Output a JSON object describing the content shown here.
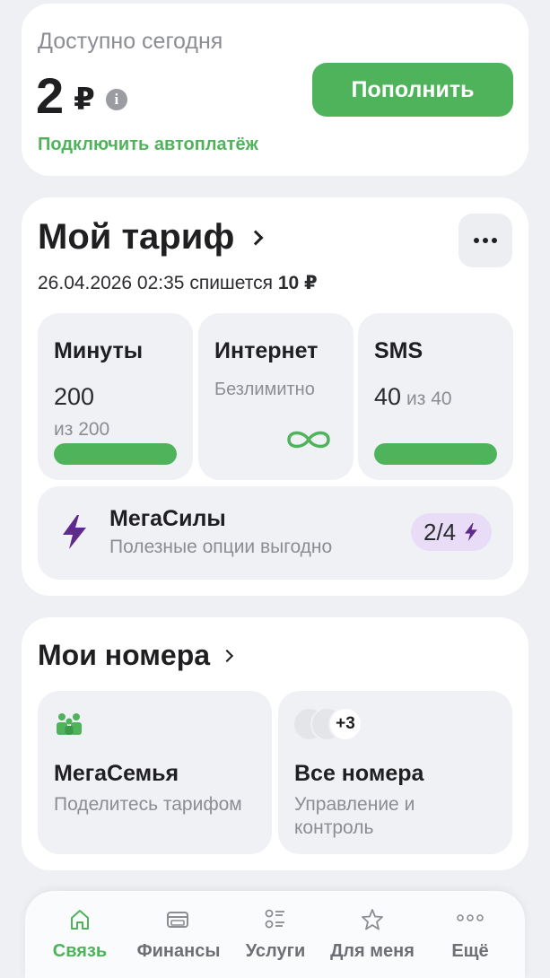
{
  "balance": {
    "caption": "Доступно сегодня",
    "amount": "2",
    "currency": "₽",
    "info_icon": "i",
    "topup_label": "Пополнить",
    "autopay_label": "Подключить автоплатёж"
  },
  "tariff": {
    "title": "Мой тариф",
    "date_text": "26.04.2026 02:35 спишется",
    "charge": "10 ₽",
    "packages": {
      "minutes": {
        "title": "Минуты",
        "value": "200",
        "sub": "из 200",
        "fill": 1.0
      },
      "internet": {
        "title": "Интернет",
        "value": "Безлимитно",
        "icon": "infinity-icon"
      },
      "sms": {
        "title": "SMS",
        "value": "40",
        "sub": "из 40",
        "fill": 1.0
      }
    },
    "megasily": {
      "title": "МегаСилы",
      "subtitle": "Полезные опции выгодно",
      "badge": "2/4"
    }
  },
  "numbers": {
    "title": "Мои номера",
    "family": {
      "title": "МегаСемья",
      "subtitle": "Поделитесь тарифом"
    },
    "all": {
      "title": "Все номера",
      "subtitle": "Управление и контроль",
      "extra_count": "+3"
    }
  },
  "nav": {
    "items": [
      {
        "label": "Связь",
        "icon": "home-icon",
        "active": true
      },
      {
        "label": "Финансы",
        "icon": "card-icon",
        "active": false
      },
      {
        "label": "Услуги",
        "icon": "list-icon",
        "active": false
      },
      {
        "label": "Для меня",
        "icon": "star-icon",
        "active": false
      },
      {
        "label": "Ещё",
        "icon": "more-icon",
        "active": false
      }
    ]
  },
  "colors": {
    "accent_green": "#4fb35c",
    "accent_purple": "#5e2a8c",
    "badge_bg": "#e8dcf6",
    "page_bg": "#eef0f4"
  }
}
